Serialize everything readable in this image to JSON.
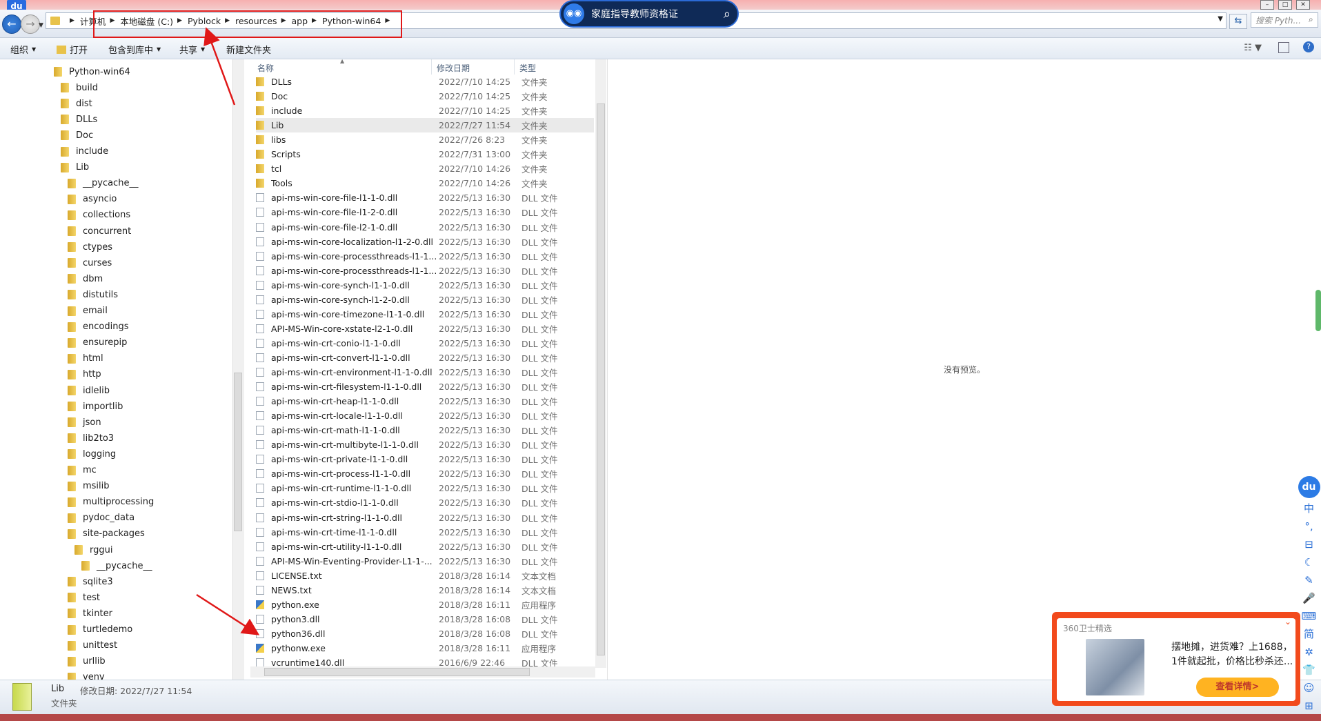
{
  "window": {
    "logo_text": "du",
    "controls": [
      "–",
      "□",
      "✕"
    ]
  },
  "address": {
    "crumbs": [
      "计算机",
      "本地磁盘 (C:)",
      "Pyblock",
      "resources",
      "app",
      "Python-win64"
    ],
    "search_placeholder": "搜索 Pyth..."
  },
  "overlay_pill": {
    "text": "家庭指导教师资格证"
  },
  "toolbar": {
    "organize": "组织",
    "open": "打开",
    "include_in_library": "包含到库中",
    "share": "共享",
    "new_folder": "新建文件夹"
  },
  "tree": {
    "items": [
      {
        "label": "Python-win64",
        "level": 0
      },
      {
        "label": "build",
        "level": 1
      },
      {
        "label": "dist",
        "level": 1
      },
      {
        "label": "DLLs",
        "level": 1
      },
      {
        "label": "Doc",
        "level": 1
      },
      {
        "label": "include",
        "level": 1
      },
      {
        "label": "Lib",
        "level": 1
      },
      {
        "label": "__pycache__",
        "level": 2
      },
      {
        "label": "asyncio",
        "level": 2
      },
      {
        "label": "collections",
        "level": 2
      },
      {
        "label": "concurrent",
        "level": 2
      },
      {
        "label": "ctypes",
        "level": 2
      },
      {
        "label": "curses",
        "level": 2
      },
      {
        "label": "dbm",
        "level": 2
      },
      {
        "label": "distutils",
        "level": 2
      },
      {
        "label": "email",
        "level": 2
      },
      {
        "label": "encodings",
        "level": 2
      },
      {
        "label": "ensurepip",
        "level": 2
      },
      {
        "label": "html",
        "level": 2
      },
      {
        "label": "http",
        "level": 2
      },
      {
        "label": "idlelib",
        "level": 2
      },
      {
        "label": "importlib",
        "level": 2
      },
      {
        "label": "json",
        "level": 2
      },
      {
        "label": "lib2to3",
        "level": 2
      },
      {
        "label": "logging",
        "level": 2
      },
      {
        "label": "mc",
        "level": 2
      },
      {
        "label": "msilib",
        "level": 2
      },
      {
        "label": "multiprocessing",
        "level": 2
      },
      {
        "label": "pydoc_data",
        "level": 2
      },
      {
        "label": "site-packages",
        "level": 2
      },
      {
        "label": "rggui",
        "level": 3
      },
      {
        "label": "__pycache__",
        "level": 4
      },
      {
        "label": "sqlite3",
        "level": 2
      },
      {
        "label": "test",
        "level": 2
      },
      {
        "label": "tkinter",
        "level": 2
      },
      {
        "label": "turtledemo",
        "level": 2
      },
      {
        "label": "unittest",
        "level": 2
      },
      {
        "label": "urllib",
        "level": 2
      },
      {
        "label": "venv",
        "level": 2
      }
    ]
  },
  "list": {
    "headers": {
      "name": "名称",
      "modified": "修改日期",
      "type": "类型"
    },
    "rows": [
      {
        "name": "DLLs",
        "date": "2022/7/10 14:25",
        "type": "文件夹",
        "icon": "folder"
      },
      {
        "name": "Doc",
        "date": "2022/7/10 14:25",
        "type": "文件夹",
        "icon": "folder"
      },
      {
        "name": "include",
        "date": "2022/7/10 14:25",
        "type": "文件夹",
        "icon": "folder"
      },
      {
        "name": "Lib",
        "date": "2022/7/27 11:54",
        "type": "文件夹",
        "icon": "folder",
        "selected": true
      },
      {
        "name": "libs",
        "date": "2022/7/26 8:23",
        "type": "文件夹",
        "icon": "folder"
      },
      {
        "name": "Scripts",
        "date": "2022/7/31 13:00",
        "type": "文件夹",
        "icon": "folder"
      },
      {
        "name": "tcl",
        "date": "2022/7/10 14:26",
        "type": "文件夹",
        "icon": "folder"
      },
      {
        "name": "Tools",
        "date": "2022/7/10 14:26",
        "type": "文件夹",
        "icon": "folder"
      },
      {
        "name": "api-ms-win-core-file-l1-1-0.dll",
        "date": "2022/5/13 16:30",
        "type": "DLL 文件",
        "icon": "file"
      },
      {
        "name": "api-ms-win-core-file-l1-2-0.dll",
        "date": "2022/5/13 16:30",
        "type": "DLL 文件",
        "icon": "file"
      },
      {
        "name": "api-ms-win-core-file-l2-1-0.dll",
        "date": "2022/5/13 16:30",
        "type": "DLL 文件",
        "icon": "file"
      },
      {
        "name": "api-ms-win-core-localization-l1-2-0.dll",
        "date": "2022/5/13 16:30",
        "type": "DLL 文件",
        "icon": "file"
      },
      {
        "name": "api-ms-win-core-processthreads-l1-1...",
        "date": "2022/5/13 16:30",
        "type": "DLL 文件",
        "icon": "file"
      },
      {
        "name": "api-ms-win-core-processthreads-l1-1...",
        "date": "2022/5/13 16:30",
        "type": "DLL 文件",
        "icon": "file"
      },
      {
        "name": "api-ms-win-core-synch-l1-1-0.dll",
        "date": "2022/5/13 16:30",
        "type": "DLL 文件",
        "icon": "file"
      },
      {
        "name": "api-ms-win-core-synch-l1-2-0.dll",
        "date": "2022/5/13 16:30",
        "type": "DLL 文件",
        "icon": "file"
      },
      {
        "name": "api-ms-win-core-timezone-l1-1-0.dll",
        "date": "2022/5/13 16:30",
        "type": "DLL 文件",
        "icon": "file"
      },
      {
        "name": "API-MS-Win-core-xstate-l2-1-0.dll",
        "date": "2022/5/13 16:30",
        "type": "DLL 文件",
        "icon": "file"
      },
      {
        "name": "api-ms-win-crt-conio-l1-1-0.dll",
        "date": "2022/5/13 16:30",
        "type": "DLL 文件",
        "icon": "file"
      },
      {
        "name": "api-ms-win-crt-convert-l1-1-0.dll",
        "date": "2022/5/13 16:30",
        "type": "DLL 文件",
        "icon": "file"
      },
      {
        "name": "api-ms-win-crt-environment-l1-1-0.dll",
        "date": "2022/5/13 16:30",
        "type": "DLL 文件",
        "icon": "file"
      },
      {
        "name": "api-ms-win-crt-filesystem-l1-1-0.dll",
        "date": "2022/5/13 16:30",
        "type": "DLL 文件",
        "icon": "file"
      },
      {
        "name": "api-ms-win-crt-heap-l1-1-0.dll",
        "date": "2022/5/13 16:30",
        "type": "DLL 文件",
        "icon": "file"
      },
      {
        "name": "api-ms-win-crt-locale-l1-1-0.dll",
        "date": "2022/5/13 16:30",
        "type": "DLL 文件",
        "icon": "file"
      },
      {
        "name": "api-ms-win-crt-math-l1-1-0.dll",
        "date": "2022/5/13 16:30",
        "type": "DLL 文件",
        "icon": "file"
      },
      {
        "name": "api-ms-win-crt-multibyte-l1-1-0.dll",
        "date": "2022/5/13 16:30",
        "type": "DLL 文件",
        "icon": "file"
      },
      {
        "name": "api-ms-win-crt-private-l1-1-0.dll",
        "date": "2022/5/13 16:30",
        "type": "DLL 文件",
        "icon": "file"
      },
      {
        "name": "api-ms-win-crt-process-l1-1-0.dll",
        "date": "2022/5/13 16:30",
        "type": "DLL 文件",
        "icon": "file"
      },
      {
        "name": "api-ms-win-crt-runtime-l1-1-0.dll",
        "date": "2022/5/13 16:30",
        "type": "DLL 文件",
        "icon": "file"
      },
      {
        "name": "api-ms-win-crt-stdio-l1-1-0.dll",
        "date": "2022/5/13 16:30",
        "type": "DLL 文件",
        "icon": "file"
      },
      {
        "name": "api-ms-win-crt-string-l1-1-0.dll",
        "date": "2022/5/13 16:30",
        "type": "DLL 文件",
        "icon": "file"
      },
      {
        "name": "api-ms-win-crt-time-l1-1-0.dll",
        "date": "2022/5/13 16:30",
        "type": "DLL 文件",
        "icon": "file"
      },
      {
        "name": "api-ms-win-crt-utility-l1-1-0.dll",
        "date": "2022/5/13 16:30",
        "type": "DLL 文件",
        "icon": "file"
      },
      {
        "name": "API-MS-Win-Eventing-Provider-L1-1-...",
        "date": "2022/5/13 16:30",
        "type": "DLL 文件",
        "icon": "file"
      },
      {
        "name": "LICENSE.txt",
        "date": "2018/3/28 16:14",
        "type": "文本文档",
        "icon": "file"
      },
      {
        "name": "NEWS.txt",
        "date": "2018/3/28 16:14",
        "type": "文本文档",
        "icon": "file"
      },
      {
        "name": "python.exe",
        "date": "2018/3/28 16:11",
        "type": "应用程序",
        "icon": "exe"
      },
      {
        "name": "python3.dll",
        "date": "2018/3/28 16:08",
        "type": "DLL 文件",
        "icon": "file"
      },
      {
        "name": "python36.dll",
        "date": "2018/3/28 16:08",
        "type": "DLL 文件",
        "icon": "file"
      },
      {
        "name": "pythonw.exe",
        "date": "2018/3/28 16:11",
        "type": "应用程序",
        "icon": "exe"
      },
      {
        "name": "vcruntime140.dll",
        "date": "2016/6/9 22:46",
        "type": "DLL 文件",
        "icon": "file"
      }
    ]
  },
  "preview": {
    "empty_text": "没有预览。"
  },
  "status": {
    "name": "Lib",
    "modified": "修改日期: 2022/7/27 11:54",
    "type": "文件夹"
  },
  "sidebar_tools": {
    "logo": "du",
    "items": [
      "中",
      "°,",
      "⊟",
      "☾",
      "✎",
      "🎤",
      "⌨",
      "简",
      "✲",
      "👕",
      "☺",
      "⊞"
    ]
  },
  "ad": {
    "title": "360卫士精选",
    "close": "⌄",
    "text": "摆地摊，进货难？上1688，1件就起批，价格比秒杀还...",
    "button": "查看详情>"
  },
  "colors": {
    "accent_red": "#e01818",
    "ad_orange": "#f24a1c",
    "selection": "#eaeaea"
  }
}
